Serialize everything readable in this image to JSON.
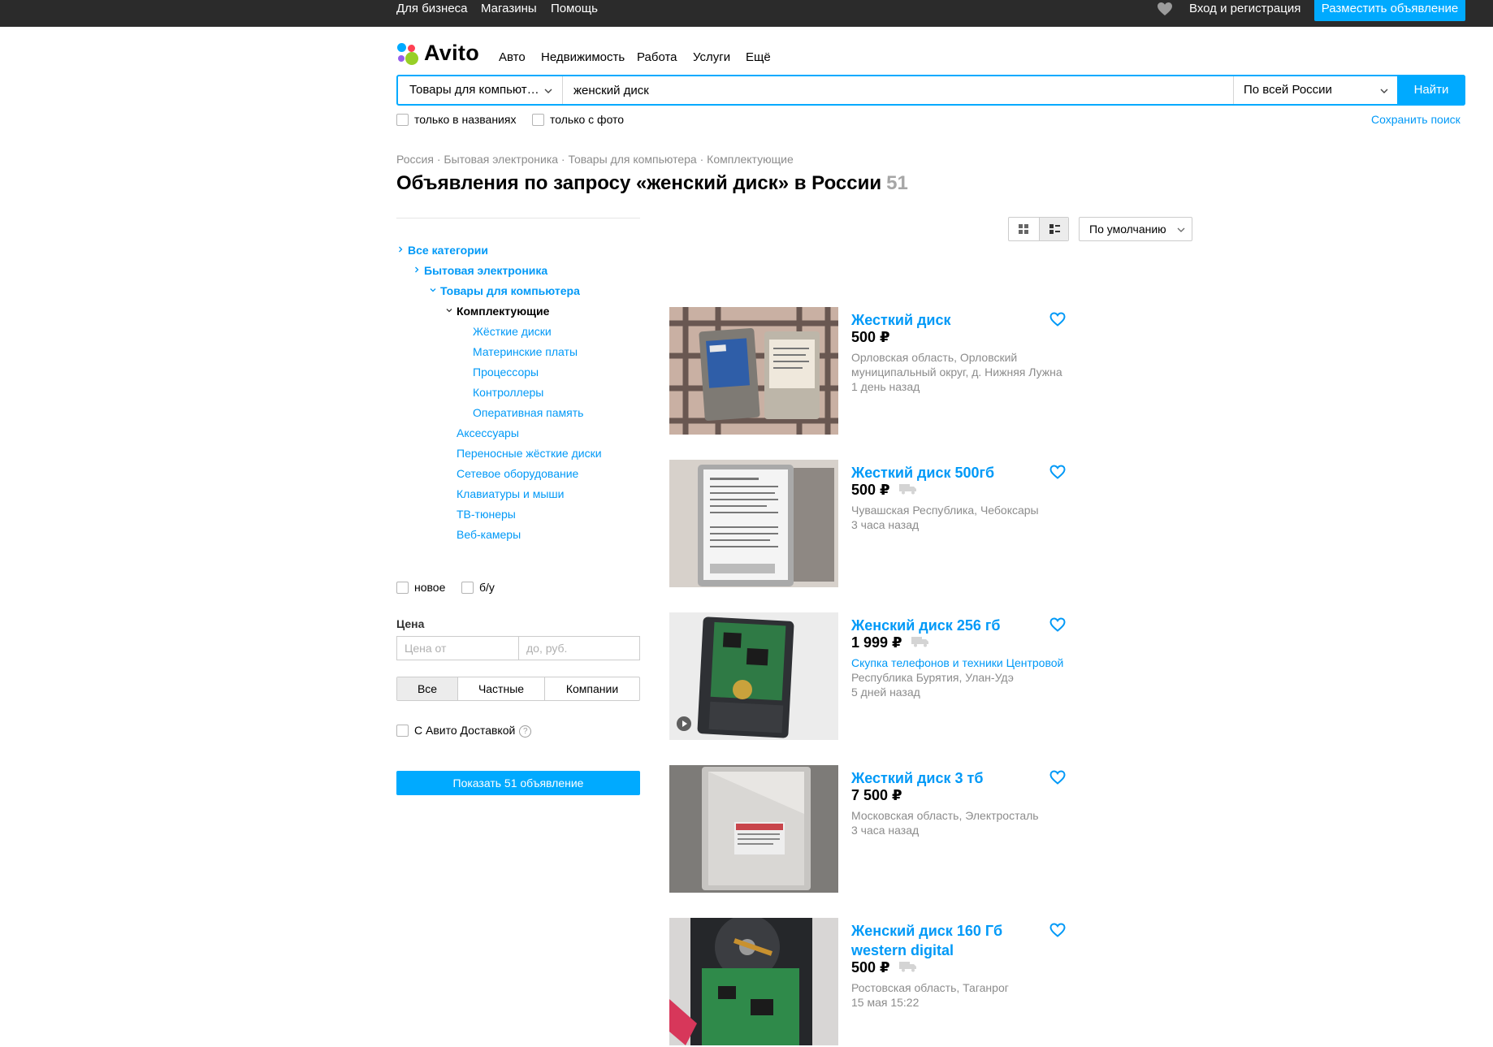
{
  "topbar": {
    "for_business": "Для бизнеса",
    "shops": "Магазины",
    "help": "Помощь",
    "login": "Вход и регистрация",
    "place_ad": "Разместить объявление"
  },
  "logo": {
    "text": "Avito"
  },
  "nav": {
    "auto": "Авто",
    "realty": "Недвижимость",
    "work": "Работа",
    "services": "Услуги",
    "more": "Ещё"
  },
  "search": {
    "category": "Товары для компьют…",
    "query": "женский диск",
    "region": "По всей России",
    "button": "Найти",
    "only_titles": "только в названиях",
    "only_photo": "только с фото",
    "save": "Сохранить поиск"
  },
  "breadcrumbs": {
    "russia": "Россия",
    "electronics": "Бытовая электроника",
    "computer": "Товары для компьютера",
    "components": "Комплектующие",
    "sep": "·"
  },
  "page_title": {
    "text": "Объявления по запросу «женский диск» в России",
    "count": "51"
  },
  "sidebar": {
    "categories": [
      {
        "label": "Все категории"
      },
      {
        "label": "Бытовая электроника"
      },
      {
        "label": "Товары для компьютера"
      },
      {
        "label": "Комплектующие"
      },
      {
        "label": "Жёсткие диски"
      },
      {
        "label": "Материнские платы"
      },
      {
        "label": "Процессоры"
      },
      {
        "label": "Контроллеры"
      },
      {
        "label": "Оперативная память"
      },
      {
        "label": "Аксессуары"
      },
      {
        "label": "Переносные жёсткие диски"
      },
      {
        "label": "Сетевое оборудование"
      },
      {
        "label": "Клавиатуры и мыши"
      },
      {
        "label": "ТВ-тюнеры"
      },
      {
        "label": "Веб-камеры"
      }
    ],
    "condition_new": "новое",
    "condition_used": "б/у",
    "price_label": "Цена",
    "price_from_placeholder": "Цена от",
    "price_to_placeholder": "до, руб.",
    "seller_all": "Все",
    "seller_private": "Частные",
    "seller_companies": "Компании",
    "delivery": "С Авито Доставкой",
    "help_mark": "?",
    "show_button": "Показать 51 объявление"
  },
  "sort": {
    "selected": "По умолчанию"
  },
  "listings": [
    {
      "title": "Жесткий диск",
      "price": "500 ₽",
      "location": "Орловская область, Орловский муниципальный округ, д. Нижняя Лужна",
      "date": "1 день назад"
    },
    {
      "title": "Жесткий диск 500гб",
      "price": "500 ₽",
      "location": "Чувашская Республика, Чебоксары",
      "date": "3 часа назад"
    },
    {
      "title": "Женский диск 256 гб",
      "price": "1 999 ₽",
      "seller": "Скупка телефонов и техники Центровой",
      "location": "Республика Бурятия, Улан-Удэ",
      "date": "5 дней назад"
    },
    {
      "title": "Жесткий диск 3 тб",
      "price": "7 500 ₽",
      "location": "Московская область, Электросталь",
      "date": "3 часа назад"
    },
    {
      "title": "Женский диск 160 Гб western digital",
      "price": "500 ₽",
      "location": "Ростовская область, Таганрог",
      "date": "15 мая 15:22"
    }
  ],
  "colors": {
    "accent": "#00aaff",
    "link": "#0099f7",
    "topbar": "#2b2b2b"
  }
}
